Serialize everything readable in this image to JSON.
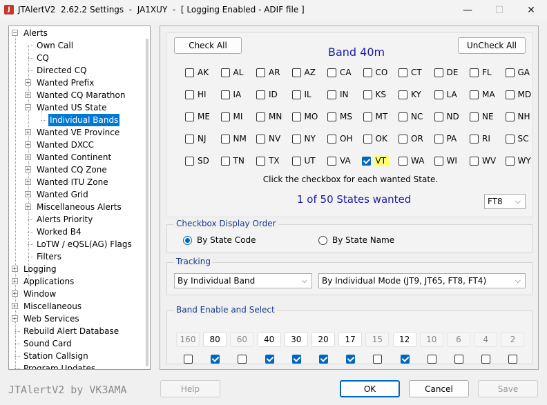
{
  "window": {
    "title": "JTAlertV2  2.62.2 Settings  -  JA1XUY  -  [ Logging Enabled - ADIF file ]",
    "minimize": "—",
    "maximize": "☐",
    "close": "✕"
  },
  "tree": {
    "items": [
      {
        "label": "Alerts",
        "expander": "−"
      },
      {
        "label": "Own Call"
      },
      {
        "label": "CQ"
      },
      {
        "label": "Directed CQ"
      },
      {
        "label": "Wanted Prefix",
        "expander": "+"
      },
      {
        "label": "Wanted CQ Marathon",
        "expander": "+"
      },
      {
        "label": "Wanted US State",
        "expander": "−"
      },
      {
        "label": "Individual Bands"
      },
      {
        "label": "Wanted VE Province",
        "expander": "+"
      },
      {
        "label": "Wanted DXCC",
        "expander": "+"
      },
      {
        "label": "Wanted Continent",
        "expander": "+"
      },
      {
        "label": "Wanted CQ Zone",
        "expander": "+"
      },
      {
        "label": "Wanted ITU Zone",
        "expander": "+"
      },
      {
        "label": "Wanted Grid",
        "expander": "+"
      },
      {
        "label": "Miscellaneous Alerts",
        "expander": "+"
      },
      {
        "label": "Alerts Priority"
      },
      {
        "label": "Worked B4"
      },
      {
        "label": "LoTW / eQSL(AG) Flags"
      },
      {
        "label": "Filters"
      },
      {
        "label": "Logging",
        "expander": "+"
      },
      {
        "label": "Applications",
        "expander": "+"
      },
      {
        "label": "Window",
        "expander": "+"
      },
      {
        "label": "Miscellaneous",
        "expander": "+"
      },
      {
        "label": "Web Services",
        "expander": "+"
      },
      {
        "label": "Rebuild Alert Database"
      },
      {
        "label": "Sound Card"
      },
      {
        "label": "Station Callsign"
      },
      {
        "label": "Program Updates"
      }
    ]
  },
  "band_panel": {
    "check_all": "Check All",
    "uncheck_all": "UnCheck All",
    "title": "Band 40m",
    "states": [
      {
        "code": "AK",
        "checked": false
      },
      {
        "code": "AL",
        "checked": false
      },
      {
        "code": "AR",
        "checked": false
      },
      {
        "code": "AZ",
        "checked": false
      },
      {
        "code": "CA",
        "checked": false
      },
      {
        "code": "CO",
        "checked": false
      },
      {
        "code": "CT",
        "checked": false
      },
      {
        "code": "DE",
        "checked": false
      },
      {
        "code": "FL",
        "checked": false
      },
      {
        "code": "GA",
        "checked": false
      },
      {
        "code": "HI",
        "checked": false
      },
      {
        "code": "IA",
        "checked": false
      },
      {
        "code": "ID",
        "checked": false
      },
      {
        "code": "IL",
        "checked": false
      },
      {
        "code": "IN",
        "checked": false
      },
      {
        "code": "KS",
        "checked": false
      },
      {
        "code": "KY",
        "checked": false
      },
      {
        "code": "LA",
        "checked": false
      },
      {
        "code": "MA",
        "checked": false
      },
      {
        "code": "MD",
        "checked": false
      },
      {
        "code": "ME",
        "checked": false
      },
      {
        "code": "MI",
        "checked": false
      },
      {
        "code": "MN",
        "checked": false
      },
      {
        "code": "MO",
        "checked": false
      },
      {
        "code": "MS",
        "checked": false
      },
      {
        "code": "MT",
        "checked": false
      },
      {
        "code": "NC",
        "checked": false
      },
      {
        "code": "ND",
        "checked": false
      },
      {
        "code": "NE",
        "checked": false
      },
      {
        "code": "NH",
        "checked": false
      },
      {
        "code": "NJ",
        "checked": false
      },
      {
        "code": "NM",
        "checked": false
      },
      {
        "code": "NV",
        "checked": false
      },
      {
        "code": "NY",
        "checked": false
      },
      {
        "code": "OH",
        "checked": false
      },
      {
        "code": "OK",
        "checked": false
      },
      {
        "code": "OR",
        "checked": false
      },
      {
        "code": "PA",
        "checked": false
      },
      {
        "code": "RI",
        "checked": false
      },
      {
        "code": "SC",
        "checked": false
      },
      {
        "code": "SD",
        "checked": false
      },
      {
        "code": "TN",
        "checked": false
      },
      {
        "code": "TX",
        "checked": false
      },
      {
        "code": "UT",
        "checked": false
      },
      {
        "code": "VA",
        "checked": false
      },
      {
        "code": "VT",
        "checked": true
      },
      {
        "code": "WA",
        "checked": false
      },
      {
        "code": "WI",
        "checked": false
      },
      {
        "code": "WV",
        "checked": false
      },
      {
        "code": "WY",
        "checked": false
      }
    ],
    "hint": "Click the checkbox for each wanted State.",
    "count": "1 of 50 States wanted",
    "mode_select": "FT8",
    "highlight_color": "#ffff70"
  },
  "display_order": {
    "label": "Checkbox Display Order",
    "option_code": "By State Code",
    "option_name": "By State Name",
    "selected": "By State Code"
  },
  "tracking": {
    "label": "Tracking",
    "band_select": "By Individual Band",
    "mode_select": "By Individual Mode (JT9, JT65, FT8, FT4)"
  },
  "band_enable": {
    "label": "Band Enable and Select",
    "bands": [
      {
        "name": "160",
        "enabled": false,
        "checked": false
      },
      {
        "name": "80",
        "enabled": true,
        "checked": true
      },
      {
        "name": "60",
        "enabled": false,
        "checked": false
      },
      {
        "name": "40",
        "enabled": true,
        "checked": true
      },
      {
        "name": "30",
        "enabled": true,
        "checked": true
      },
      {
        "name": "20",
        "enabled": true,
        "checked": true
      },
      {
        "name": "17",
        "enabled": true,
        "checked": true
      },
      {
        "name": "15",
        "enabled": false,
        "checked": false
      },
      {
        "name": "12",
        "enabled": true,
        "checked": true
      },
      {
        "name": "10",
        "enabled": false,
        "checked": false
      },
      {
        "name": "6",
        "enabled": false,
        "checked": false
      },
      {
        "name": "4",
        "enabled": false,
        "checked": false
      },
      {
        "name": "2",
        "enabled": false,
        "checked": false
      }
    ]
  },
  "footer": {
    "brand": "JTAlertV2 by VK3AMA",
    "help": "Help",
    "ok": "OK",
    "cancel": "Cancel",
    "save": "Save"
  },
  "colors": {
    "accent": "#0067c0",
    "title_blue": "#1a1aa8",
    "selection": "#0078d7"
  }
}
